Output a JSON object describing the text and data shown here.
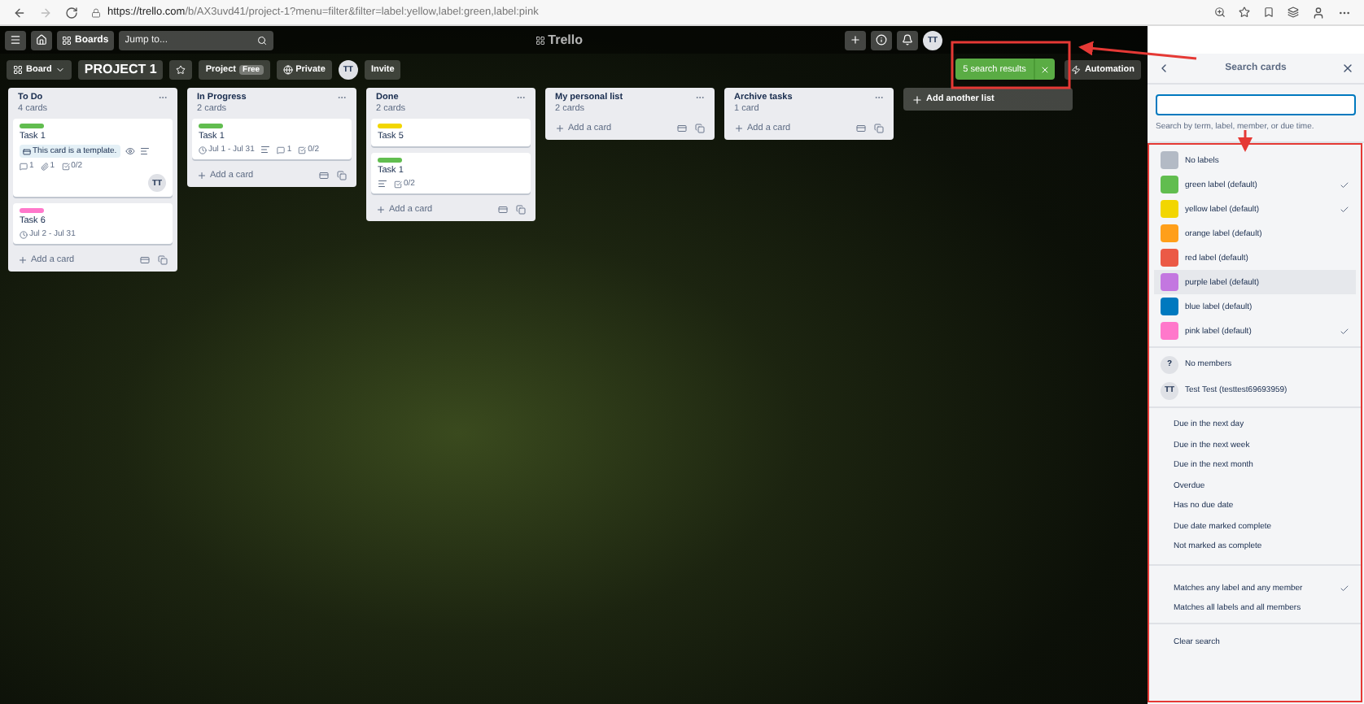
{
  "browser": {
    "url_host": "https://trello.com",
    "url_path": "/b/AX3uvd41/project-1?menu=filter&filter=label:yellow,label:green,label:pink"
  },
  "nav": {
    "boards": "Boards",
    "search_placeholder": "Jump to...",
    "logo": "Trello",
    "avatar": "TT"
  },
  "board_bar": {
    "view": "Board",
    "title": "PROJECT 1",
    "workspace": "Project",
    "plan": "Free",
    "visibility": "Private",
    "member": "TT",
    "invite": "Invite",
    "search_results": "5 search results",
    "automation": "Automation"
  },
  "lists": [
    {
      "title": "To Do",
      "count": "4 cards",
      "add": "Add a card",
      "cards": [
        {
          "title": "Task 1",
          "color": "#61bd4f",
          "template_note": "This card is a template.",
          "badges": [
            {
              "kind": "comments",
              "text": "1"
            },
            {
              "kind": "attachments",
              "text": "1"
            },
            {
              "kind": "checklist",
              "text": "0/2"
            }
          ],
          "member": "TT"
        },
        {
          "title": "Task 6",
          "color": "#ff78cb",
          "badges": [
            {
              "kind": "due",
              "text": "Jul 2 - Jul 31"
            }
          ]
        }
      ]
    },
    {
      "title": "In Progress",
      "count": "2 cards",
      "add": "Add a card",
      "cards": [
        {
          "title": "Task 1",
          "color": "#61bd4f",
          "badges": [
            {
              "kind": "due",
              "text": "Jul 1 - Jul 31"
            },
            {
              "kind": "description"
            },
            {
              "kind": "comments",
              "text": "1"
            },
            {
              "kind": "checklist",
              "text": "0/2"
            }
          ]
        }
      ]
    },
    {
      "title": "Done",
      "count": "2 cards",
      "add": "Add a card",
      "cards": [
        {
          "title": "Task 5",
          "color": "#f2d600"
        },
        {
          "title": "Task 1",
          "color": "#61bd4f",
          "badges": [
            {
              "kind": "description"
            },
            {
              "kind": "checklist",
              "text": "0/2"
            }
          ]
        }
      ]
    },
    {
      "title": "My personal list",
      "count": "2 cards",
      "add": "Add a card"
    },
    {
      "title": "Archive tasks",
      "count": "1 card",
      "add": "Add a card"
    }
  ],
  "add_list": "Add another list",
  "sidebar": {
    "title": "Search cards",
    "hint": "Search by term, label, member, or due time.",
    "labels": [
      {
        "name": "No labels",
        "color": "#b3bac5",
        "checked": false,
        "hovered": false
      },
      {
        "name": "green label (default)",
        "color": "#61bd4f",
        "checked": true,
        "hovered": false
      },
      {
        "name": "yellow label (default)",
        "color": "#f2d600",
        "checked": true,
        "hovered": false
      },
      {
        "name": "orange label (default)",
        "color": "#ff9f1a",
        "checked": false,
        "hovered": false
      },
      {
        "name": "red label (default)",
        "color": "#eb5a46",
        "checked": false,
        "hovered": false
      },
      {
        "name": "purple label (default)",
        "color": "#c377e0",
        "checked": false,
        "hovered": true
      },
      {
        "name": "blue label (default)",
        "color": "#0079bf",
        "checked": false,
        "hovered": false
      },
      {
        "name": "pink label (default)",
        "color": "#ff78cb",
        "checked": true,
        "hovered": false
      }
    ],
    "members": [
      {
        "initials": "?",
        "name": "No members",
        "checked": false
      },
      {
        "initials": "TT",
        "name": "Test Test (testtest69693959)",
        "checked": false
      }
    ],
    "due": [
      {
        "name": "Due in the next day",
        "checked": false
      },
      {
        "name": "Due in the next week",
        "checked": false
      },
      {
        "name": "Due in the next month",
        "checked": false
      },
      {
        "name": "Overdue",
        "checked": false
      },
      {
        "name": "Has no due date",
        "checked": false
      },
      {
        "name": "Due date marked complete",
        "checked": false
      },
      {
        "name": "Not marked as complete",
        "checked": false
      }
    ],
    "match": [
      {
        "name": "Matches any label and any member",
        "checked": true
      },
      {
        "name": "Matches all labels and all members",
        "checked": false
      }
    ],
    "clear": "Clear search"
  }
}
